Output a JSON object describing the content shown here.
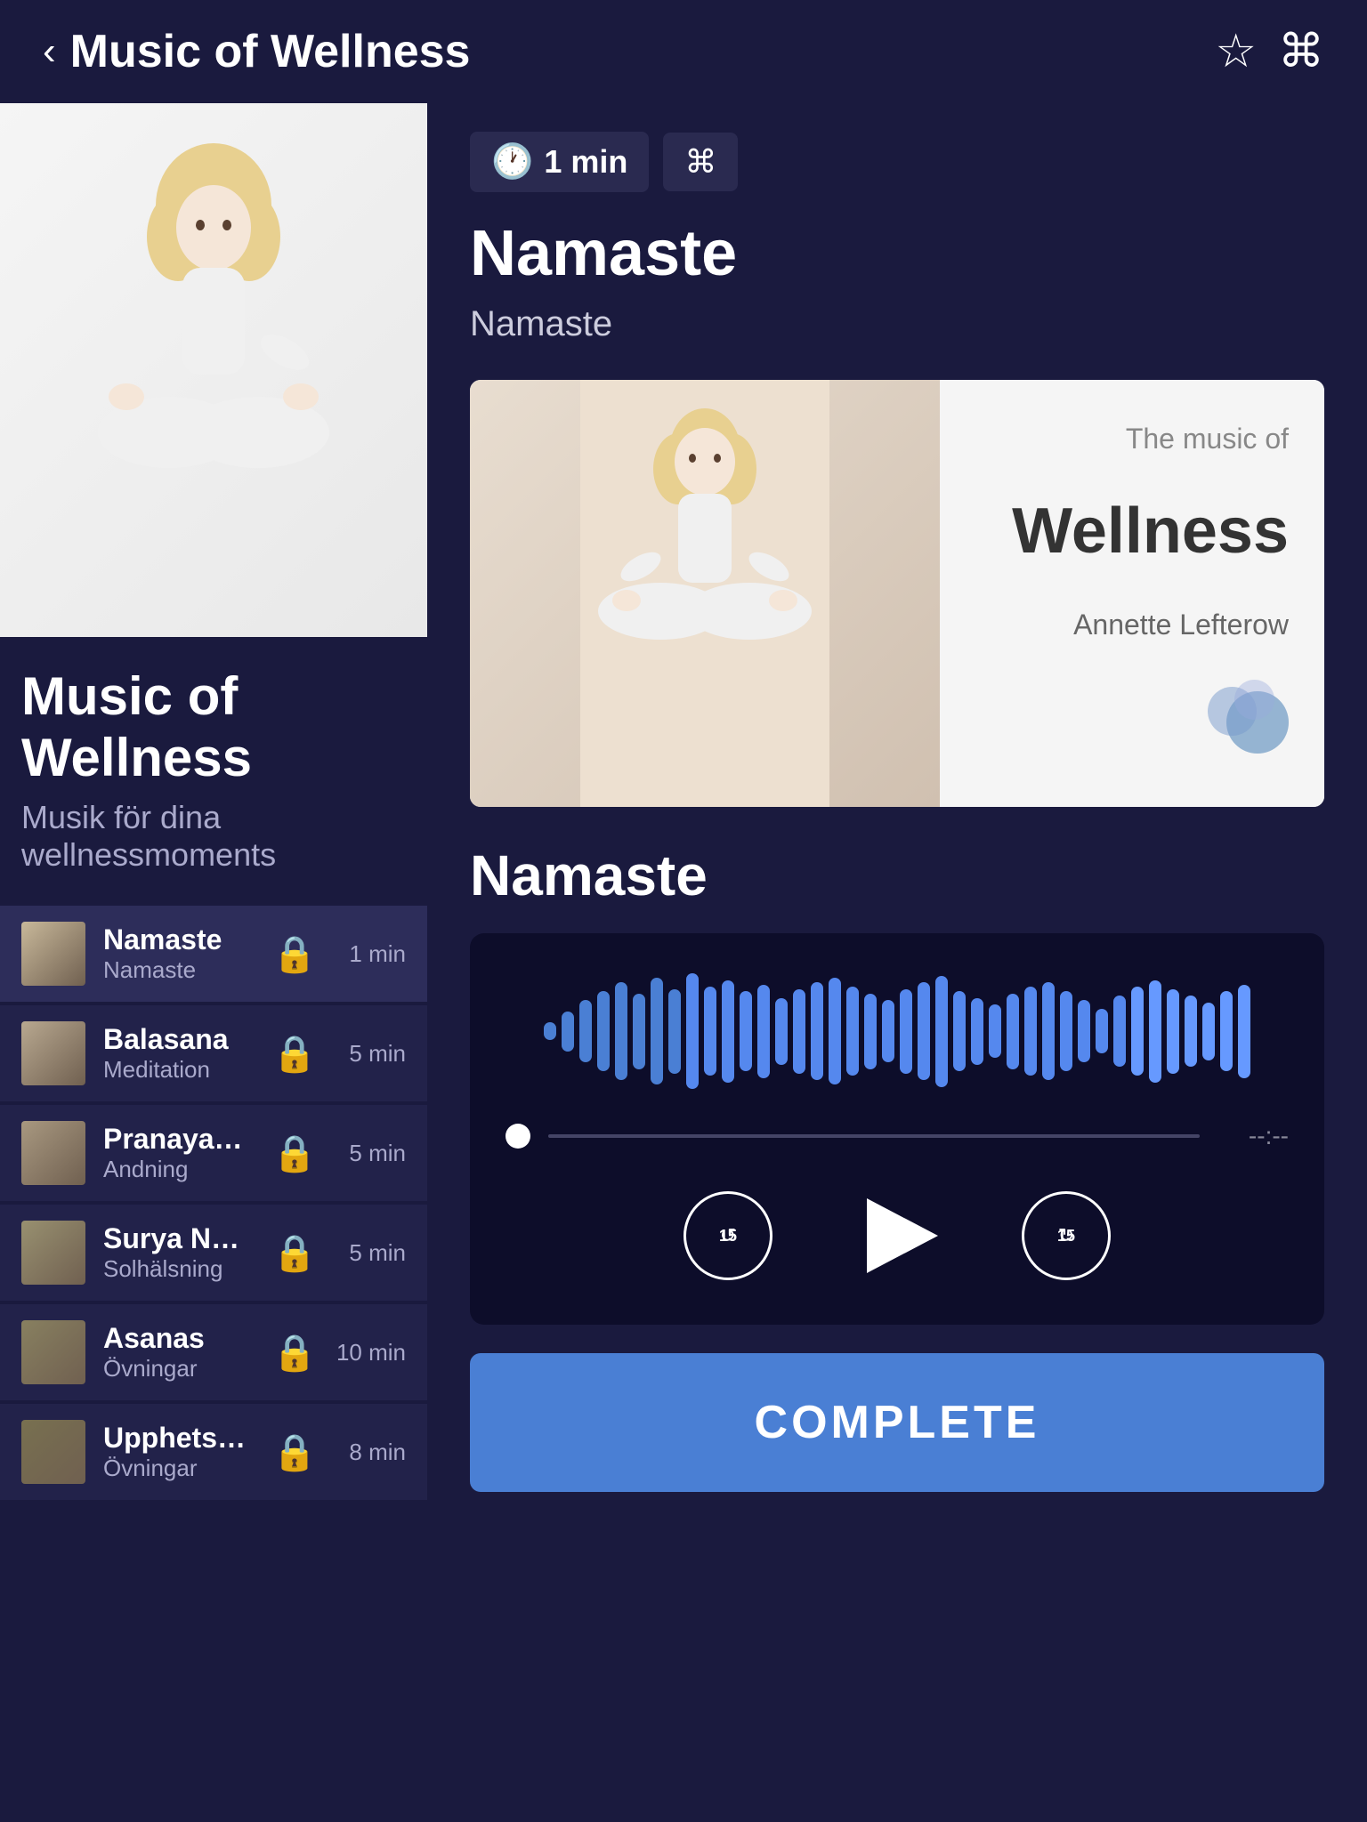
{
  "header": {
    "back_label": "‹",
    "title": "Music of Wellness",
    "star_icon": "☆",
    "link_icon": "⌘"
  },
  "album": {
    "title": "Music of Wellness",
    "subtitle": "Musik för dina wellnessmoments",
    "artist": "Annette Lefterow",
    "art_text_top": "The music of",
    "art_text_main": "Wellness"
  },
  "track_detail": {
    "duration": "1 min",
    "title": "Namaste",
    "subtitle": "Namaste",
    "section_title": "Namaste",
    "progress_time": "--:--",
    "complete_label": "COMPLETE"
  },
  "tracks": [
    {
      "name": "Namaste",
      "desc": "Namaste",
      "duration": "1 min",
      "locked": true
    },
    {
      "name": "Balasana",
      "desc": "Meditation",
      "duration": "5 min",
      "locked": true
    },
    {
      "name": "Pranayama",
      "desc": "Andning",
      "duration": "5 min",
      "locked": true
    },
    {
      "name": "Surya Namaste",
      "desc": "Solhälsning",
      "duration": "5 min",
      "locked": true
    },
    {
      "name": "Asanas",
      "desc": "Övningar",
      "duration": "10 min",
      "locked": true
    },
    {
      "name": "Upphetsning",
      "desc": "Övningar",
      "duration": "8 min",
      "locked": true
    }
  ],
  "waveform_bars": [
    20,
    45,
    70,
    90,
    110,
    85,
    120,
    95,
    130,
    100,
    115,
    90,
    105,
    75,
    95,
    110,
    120,
    100,
    85,
    70,
    95,
    110,
    125,
    90,
    75,
    60,
    85,
    100,
    110,
    90,
    70,
    50,
    80,
    100,
    115,
    95,
    80,
    65,
    90,
    105
  ],
  "controls": {
    "rewind_label": "15",
    "forward_label": "15",
    "play_icon": "▶"
  }
}
